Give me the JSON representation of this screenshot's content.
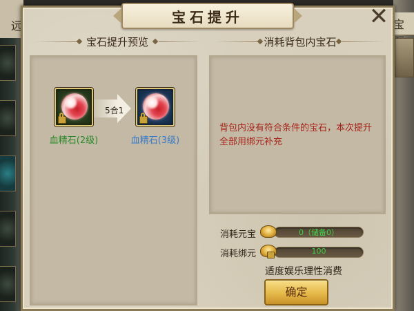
{
  "background": {
    "left_tab_label": "远",
    "right_tab_label": "宝石"
  },
  "dialog": {
    "title": "宝石提升",
    "close_label": "✕"
  },
  "preview": {
    "heading": "宝石提升预览",
    "from_gem": {
      "name": "血精石(2级)",
      "color": "#2c8a2a",
      "frame": "green"
    },
    "ratio_label": "5合1",
    "to_gem": {
      "name": "血精石(3级)",
      "color": "#3b7ac6",
      "frame": "blue"
    }
  },
  "consume": {
    "heading": "消耗背包内宝石",
    "message": "背包内没有符合条件的宝石，本次提升全部用绑元补充"
  },
  "costs": {
    "yuanbao_label": "消耗元宝",
    "yuanbao_value": "0（储备0）",
    "bangyuan_label": "消耗绑元",
    "bangyuan_value": "100"
  },
  "footer": {
    "note": "适度娱乐理性消费",
    "confirm_label": "确定"
  }
}
